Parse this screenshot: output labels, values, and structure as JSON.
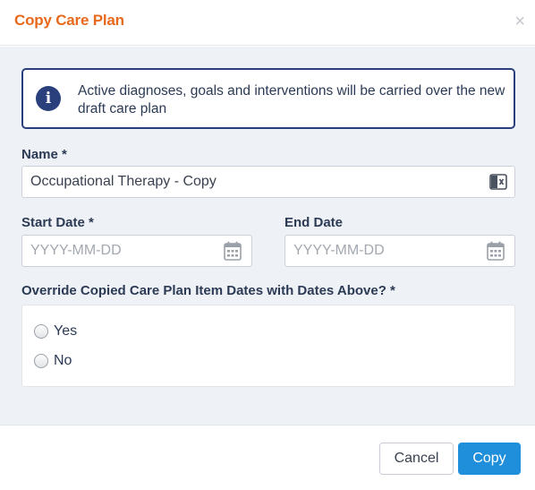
{
  "dialog": {
    "title": "Copy Care Plan",
    "close_symbol": "×"
  },
  "alert": {
    "icon": "info-circle-icon",
    "icon_glyph": "i",
    "text": "Active diagnoses, goals and interventions will be carried over the new draft care plan"
  },
  "form": {
    "name": {
      "label": "Name *",
      "value": "Occupational Therapy - Copy",
      "addon_icon": "contact-card-icon"
    },
    "start_date": {
      "label": "Start Date *",
      "placeholder": "YYYY-MM-DD",
      "value": "",
      "icon": "calendar-icon"
    },
    "end_date": {
      "label": "End Date",
      "placeholder": "YYYY-MM-DD",
      "value": "",
      "icon": "calendar-icon"
    },
    "override": {
      "label": "Override Copied Care Plan Item Dates with Dates Above? *",
      "options": [
        {
          "label": "Yes",
          "selected": false
        },
        {
          "label": "No",
          "selected": false
        }
      ]
    }
  },
  "footer": {
    "cancel_label": "Cancel",
    "copy_label": "Copy"
  },
  "colors": {
    "title": "#e8691b",
    "alert_border": "#29407d",
    "body_bg": "#eef1f5",
    "primary_button": "#1f8fdc"
  }
}
